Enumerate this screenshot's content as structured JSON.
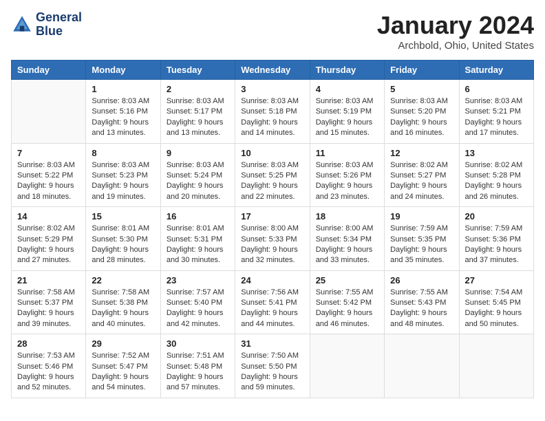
{
  "logo": {
    "line1": "General",
    "line2": "Blue"
  },
  "title": "January 2024",
  "subtitle": "Archbold, Ohio, United States",
  "days_of_week": [
    "Sunday",
    "Monday",
    "Tuesday",
    "Wednesday",
    "Thursday",
    "Friday",
    "Saturday"
  ],
  "weeks": [
    [
      {
        "date": "",
        "info": ""
      },
      {
        "date": "1",
        "info": "Sunrise: 8:03 AM\nSunset: 5:16 PM\nDaylight: 9 hours\nand 13 minutes."
      },
      {
        "date": "2",
        "info": "Sunrise: 8:03 AM\nSunset: 5:17 PM\nDaylight: 9 hours\nand 13 minutes."
      },
      {
        "date": "3",
        "info": "Sunrise: 8:03 AM\nSunset: 5:18 PM\nDaylight: 9 hours\nand 14 minutes."
      },
      {
        "date": "4",
        "info": "Sunrise: 8:03 AM\nSunset: 5:19 PM\nDaylight: 9 hours\nand 15 minutes."
      },
      {
        "date": "5",
        "info": "Sunrise: 8:03 AM\nSunset: 5:20 PM\nDaylight: 9 hours\nand 16 minutes."
      },
      {
        "date": "6",
        "info": "Sunrise: 8:03 AM\nSunset: 5:21 PM\nDaylight: 9 hours\nand 17 minutes."
      }
    ],
    [
      {
        "date": "7",
        "info": "Sunrise: 8:03 AM\nSunset: 5:22 PM\nDaylight: 9 hours\nand 18 minutes."
      },
      {
        "date": "8",
        "info": "Sunrise: 8:03 AM\nSunset: 5:23 PM\nDaylight: 9 hours\nand 19 minutes."
      },
      {
        "date": "9",
        "info": "Sunrise: 8:03 AM\nSunset: 5:24 PM\nDaylight: 9 hours\nand 20 minutes."
      },
      {
        "date": "10",
        "info": "Sunrise: 8:03 AM\nSunset: 5:25 PM\nDaylight: 9 hours\nand 22 minutes."
      },
      {
        "date": "11",
        "info": "Sunrise: 8:03 AM\nSunset: 5:26 PM\nDaylight: 9 hours\nand 23 minutes."
      },
      {
        "date": "12",
        "info": "Sunrise: 8:02 AM\nSunset: 5:27 PM\nDaylight: 9 hours\nand 24 minutes."
      },
      {
        "date": "13",
        "info": "Sunrise: 8:02 AM\nSunset: 5:28 PM\nDaylight: 9 hours\nand 26 minutes."
      }
    ],
    [
      {
        "date": "14",
        "info": "Sunrise: 8:02 AM\nSunset: 5:29 PM\nDaylight: 9 hours\nand 27 minutes."
      },
      {
        "date": "15",
        "info": "Sunrise: 8:01 AM\nSunset: 5:30 PM\nDaylight: 9 hours\nand 28 minutes."
      },
      {
        "date": "16",
        "info": "Sunrise: 8:01 AM\nSunset: 5:31 PM\nDaylight: 9 hours\nand 30 minutes."
      },
      {
        "date": "17",
        "info": "Sunrise: 8:00 AM\nSunset: 5:33 PM\nDaylight: 9 hours\nand 32 minutes."
      },
      {
        "date": "18",
        "info": "Sunrise: 8:00 AM\nSunset: 5:34 PM\nDaylight: 9 hours\nand 33 minutes."
      },
      {
        "date": "19",
        "info": "Sunrise: 7:59 AM\nSunset: 5:35 PM\nDaylight: 9 hours\nand 35 minutes."
      },
      {
        "date": "20",
        "info": "Sunrise: 7:59 AM\nSunset: 5:36 PM\nDaylight: 9 hours\nand 37 minutes."
      }
    ],
    [
      {
        "date": "21",
        "info": "Sunrise: 7:58 AM\nSunset: 5:37 PM\nDaylight: 9 hours\nand 39 minutes."
      },
      {
        "date": "22",
        "info": "Sunrise: 7:58 AM\nSunset: 5:38 PM\nDaylight: 9 hours\nand 40 minutes."
      },
      {
        "date": "23",
        "info": "Sunrise: 7:57 AM\nSunset: 5:40 PM\nDaylight: 9 hours\nand 42 minutes."
      },
      {
        "date": "24",
        "info": "Sunrise: 7:56 AM\nSunset: 5:41 PM\nDaylight: 9 hours\nand 44 minutes."
      },
      {
        "date": "25",
        "info": "Sunrise: 7:55 AM\nSunset: 5:42 PM\nDaylight: 9 hours\nand 46 minutes."
      },
      {
        "date": "26",
        "info": "Sunrise: 7:55 AM\nSunset: 5:43 PM\nDaylight: 9 hours\nand 48 minutes."
      },
      {
        "date": "27",
        "info": "Sunrise: 7:54 AM\nSunset: 5:45 PM\nDaylight: 9 hours\nand 50 minutes."
      }
    ],
    [
      {
        "date": "28",
        "info": "Sunrise: 7:53 AM\nSunset: 5:46 PM\nDaylight: 9 hours\nand 52 minutes."
      },
      {
        "date": "29",
        "info": "Sunrise: 7:52 AM\nSunset: 5:47 PM\nDaylight: 9 hours\nand 54 minutes."
      },
      {
        "date": "30",
        "info": "Sunrise: 7:51 AM\nSunset: 5:48 PM\nDaylight: 9 hours\nand 57 minutes."
      },
      {
        "date": "31",
        "info": "Sunrise: 7:50 AM\nSunset: 5:50 PM\nDaylight: 9 hours\nand 59 minutes."
      },
      {
        "date": "",
        "info": ""
      },
      {
        "date": "",
        "info": ""
      },
      {
        "date": "",
        "info": ""
      }
    ]
  ]
}
